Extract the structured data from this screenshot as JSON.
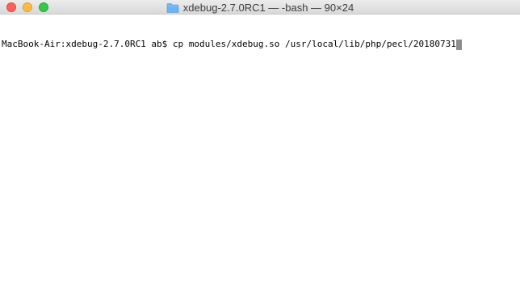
{
  "window": {
    "title": "xdebug-2.7.0RC1 — -bash — 90×24",
    "folder_icon": "folder-icon",
    "buttons": {
      "close": "close-button",
      "minimize": "minimize-button",
      "zoom": "zoom-button"
    },
    "colors": {
      "close": "#fc605b",
      "minimize": "#fdbc40",
      "zoom": "#34c84a",
      "folder": "#6ab4f5"
    }
  },
  "terminal": {
    "prompt": "MacBook-Air:xdebug-2.7.0RC1 ab$ ",
    "command": "cp modules/xdebug.so /usr/local/lib/php/pecl/20180731"
  }
}
